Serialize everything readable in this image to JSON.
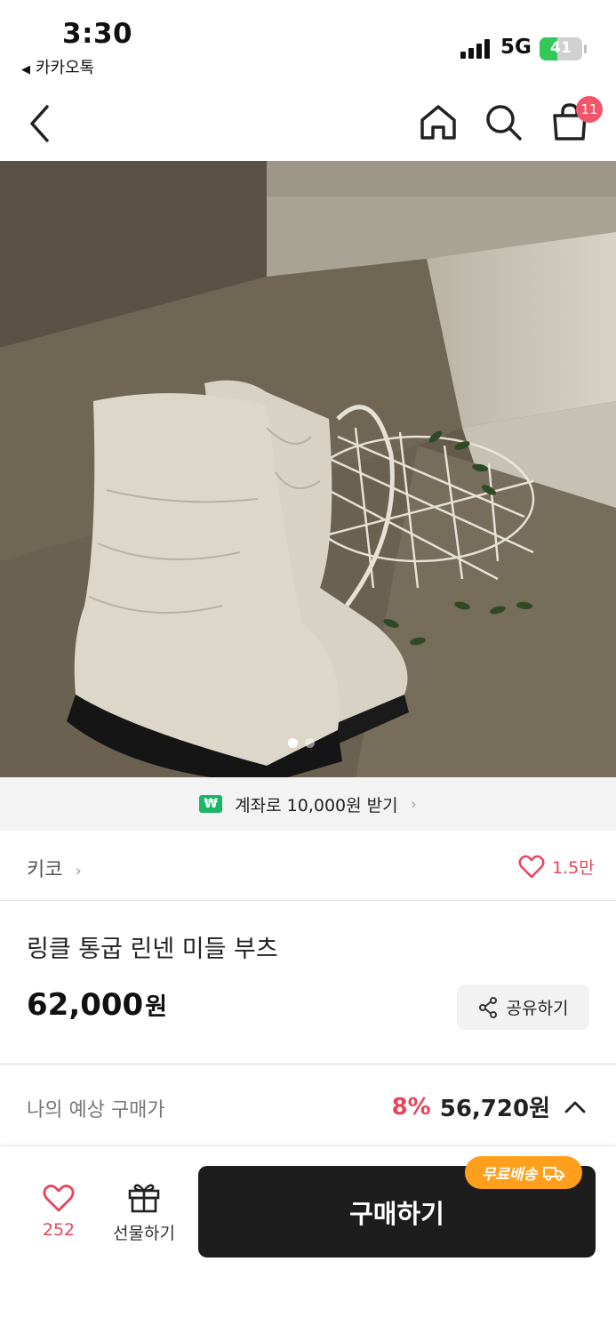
{
  "status_bar": {
    "time": "3:30",
    "back_app": "카카오톡",
    "network": "5G",
    "battery": "41",
    "battery_level": 0.41
  },
  "nav": {
    "icons": [
      "back-chevron-icon",
      "home-icon",
      "search-icon",
      "shopping-bag-icon"
    ],
    "cart_count": "11"
  },
  "hero": {
    "description_icons": [
      "expand-icon"
    ],
    "page_indicator": {
      "current": 1,
      "total": 2
    }
  },
  "promo": {
    "badge": "₩",
    "text": "계좌로 10,000원 받기",
    "chevron": "›"
  },
  "product": {
    "brand": "키코",
    "brand_chevron": "›",
    "likes": "1.5만",
    "title": "링클 통굽 린넨 미들 부츠",
    "price": "62,000",
    "price_unit": "원",
    "share_label": "공유하기"
  },
  "estimate": {
    "label": "나의 예상 구매가",
    "rate": "8%",
    "price": "56,720원"
  },
  "bottom_bar": {
    "wish_count": "252",
    "gift_label": "선물하기",
    "buy_label": "구매하기",
    "shipping_tag": "무료배송"
  },
  "colors": {
    "accent_red": "#e8445a",
    "badge_red": "#f0556a",
    "promo_green": "#1cb56a",
    "shipping_orange": "#ff9f1c",
    "buy_button": "#1d1d1d"
  }
}
